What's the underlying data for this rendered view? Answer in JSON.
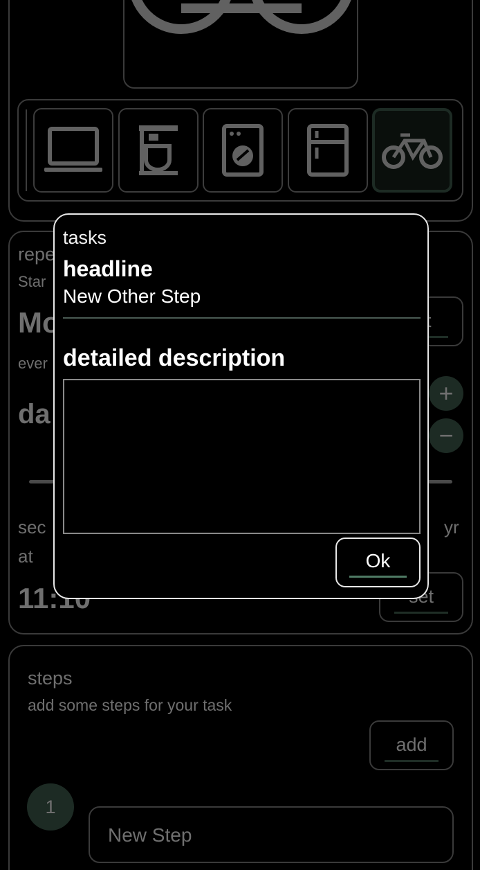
{
  "appliance_picker": {
    "items": [
      {
        "name": "laptop"
      },
      {
        "name": "coffee-machine"
      },
      {
        "name": "washing-machine"
      },
      {
        "name": "fridge"
      },
      {
        "name": "bicycle",
        "selected": true
      }
    ]
  },
  "repeat_card": {
    "title_fragment": "repe",
    "start_fragment": "Star",
    "day_fragment": "Mo",
    "right_btn_fragment": "t",
    "every_fragment": "ever",
    "unit_fragment": "da",
    "sec_label": "sec",
    "yr_label": "yr",
    "at_label": "at",
    "time": "11:10",
    "set_label": "set",
    "plus": "+",
    "minus": "−"
  },
  "steps_card": {
    "title": "steps",
    "subtitle": "add some steps for your task",
    "add_label": "add",
    "step_number": "1",
    "step_placeholder": "New Step"
  },
  "dialog": {
    "label": "tasks",
    "headline_title": "headline",
    "headline_value": "New Other Step",
    "description_title": "detailed description",
    "description_value": "",
    "ok_label": "Ok"
  },
  "colors": {
    "accent": "#4f7a64",
    "dim_accent": "#1d2b24",
    "dialog_border": "#e8e8e8"
  }
}
